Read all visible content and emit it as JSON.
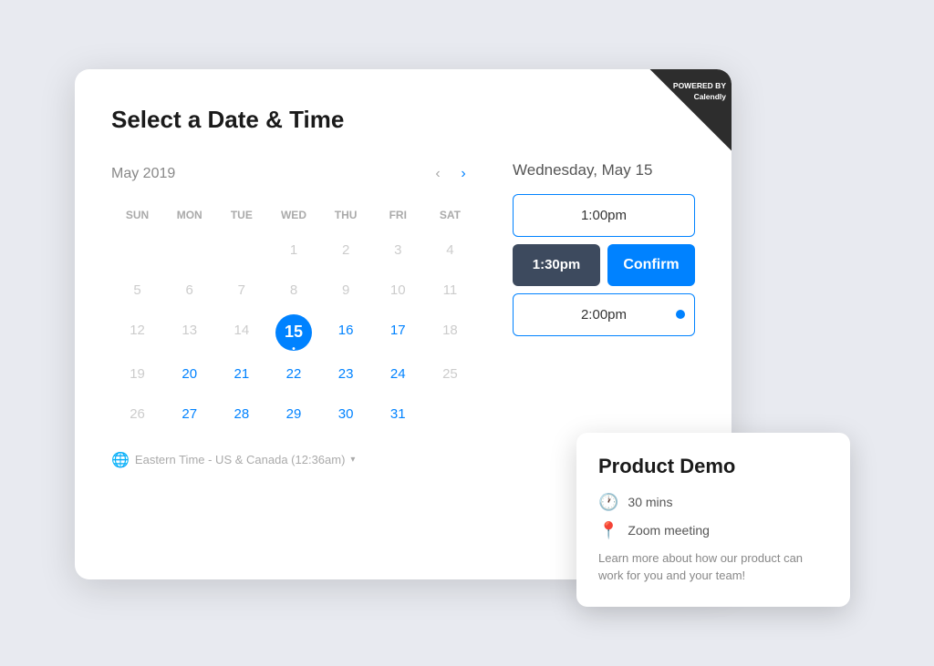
{
  "page": {
    "title": "Select a Date & Time"
  },
  "calendar": {
    "month": "May 2019",
    "prev_arrow": "‹",
    "next_arrow": "›",
    "day_headers": [
      "SUN",
      "MON",
      "TUE",
      "WED",
      "THU",
      "FRI",
      "SAT"
    ],
    "weeks": [
      [
        null,
        null,
        null,
        "1",
        "2",
        "3",
        "4"
      ],
      [
        "5",
        "6",
        "7",
        "8",
        "9",
        "10",
        "11"
      ],
      [
        "12",
        "13",
        "14",
        "15",
        "16",
        "17",
        "18"
      ],
      [
        "19",
        "20",
        "21",
        "22",
        "23",
        "24",
        "25"
      ],
      [
        "26",
        "27",
        "28",
        "29",
        "30",
        "31",
        null
      ]
    ],
    "available_days": [
      "1",
      "2",
      "3",
      "4",
      "5",
      "6",
      "7",
      "8",
      "9",
      "10",
      "11",
      "12",
      "13",
      "14",
      "15",
      "16",
      "17",
      "18",
      "19",
      "20",
      "21",
      "22",
      "23",
      "24",
      "25",
      "26",
      "27",
      "28",
      "29",
      "30",
      "31"
    ],
    "active_available": [
      "20",
      "21",
      "22",
      "23",
      "24",
      "27",
      "28",
      "29",
      "30",
      "31",
      "16",
      "17"
    ],
    "selected_day": "15",
    "timezone": "Eastern Time - US & Canada (12:36am)"
  },
  "time_panel": {
    "selected_date_label": "Wednesday, May 15",
    "slots": [
      {
        "time": "1:00pm",
        "state": "normal"
      },
      {
        "time": "1:30pm",
        "state": "selected"
      },
      {
        "time": "2:00pm",
        "state": "dot"
      }
    ],
    "confirm_label": "Confirm"
  },
  "product_demo": {
    "title": "Product Demo",
    "duration": "30 mins",
    "location": "Zoom meeting",
    "description": "Learn more about how our product can work for you and your team!"
  },
  "badge": {
    "line1": "POWERED BY",
    "line2": "Calendly"
  }
}
